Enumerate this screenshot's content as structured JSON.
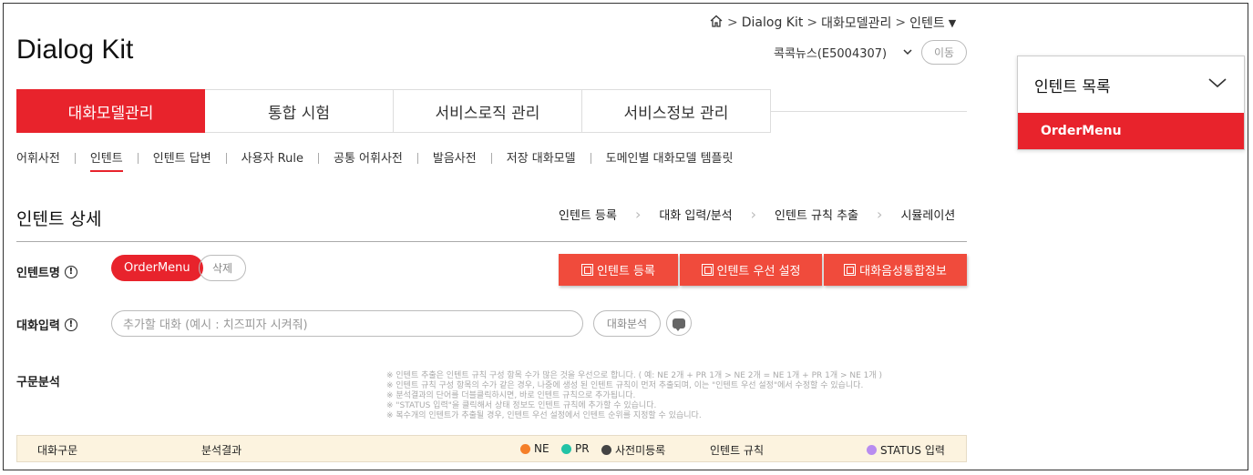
{
  "app": {
    "title": "Dialog Kit"
  },
  "breadcrumb": {
    "items": [
      "Dialog Kit",
      "대화모델관리",
      "인텐트"
    ],
    "separator": ">",
    "dropdown_glyph": "▼"
  },
  "header": {
    "site_select": "콕콕뉴스(E5004307)",
    "move_label": "이동"
  },
  "main_tabs": [
    {
      "label": "대화모델관리",
      "active": true
    },
    {
      "label": "통합 시험",
      "active": false
    },
    {
      "label": "서비스로직 관리",
      "active": false
    },
    {
      "label": "서비스정보 관리",
      "active": false
    }
  ],
  "sub_nav": [
    {
      "label": "어휘사전",
      "active": false
    },
    {
      "label": "인텐트",
      "active": true
    },
    {
      "label": "인텐트 답변",
      "active": false
    },
    {
      "label": "사용자 Rule",
      "active": false
    },
    {
      "label": "공통 어휘사전",
      "active": false
    },
    {
      "label": "발음사전",
      "active": false
    },
    {
      "label": "저장 대화모델",
      "active": false
    },
    {
      "label": "도메인별 대화모델 템플릿",
      "active": false
    }
  ],
  "section": {
    "title": "인텐트 상세",
    "steps": [
      "인텐트 등록",
      "대화 입력/분석",
      "인텐트 규칙 추출",
      "시뮬레이션"
    ]
  },
  "intent": {
    "label": "인텐트명",
    "name": "OrderMenu",
    "delete_label": "삭제",
    "buttons": [
      "인텐트 등록",
      "인텐트 우선 설정",
      "대화음성통합정보"
    ]
  },
  "dialog_input": {
    "label": "대화입력",
    "placeholder": "추가할 대화 (예시 : 치즈피자 시켜줘)",
    "analyze_label": "대화분석"
  },
  "syntax": {
    "label": "구문분석",
    "notes": [
      "※ 인텐트 추출은 인텐트 규칙 구성 항목 수가 많은 것을 우선으로 합니다. ( 예: NE 2개 + PR 1개 > NE 2개 = NE 1개 + PR 1개 > NE 1개 )",
      "※ 인텐트 규칙 구성 항목의 수가 같은 경우, 나중에 생성 된 인텐트 규칙이 먼저 추출되며, 이는 \"인텐트 우선 설정\"에서 수정할 수 있습니다.",
      "※ 분석결과의 단어를 더블클릭하시면, 바로 인텐트 규칙으로 추가됩니다.",
      "※ \"STATUS 입력\"을 클릭해서 상태 정보도 인텐트 규칙에 추가할 수 있습니다.",
      "※ 복수개의 인텐트가 추출될 경우, 인텐트 우선 설정에서 인텐트 순위를 지정할 수 있습니다."
    ]
  },
  "table": {
    "col_phrase": "대화구문",
    "col_result": "분석결과",
    "col_rule": "인텐트 규칙",
    "legend": [
      {
        "label": "NE",
        "color": "#f57f29"
      },
      {
        "label": "PR",
        "color": "#22c3a6"
      },
      {
        "label": "사전미등록",
        "color": "#444444"
      }
    ],
    "status": {
      "label": "STATUS 입력",
      "color": "#b88cf0"
    }
  },
  "side_panel": {
    "title": "인텐트 목록",
    "items": [
      "OrderMenu"
    ]
  },
  "colors": {
    "accent": "#e8232c",
    "action": "#f04b3c",
    "table_header_bg": "#fcf3df"
  }
}
